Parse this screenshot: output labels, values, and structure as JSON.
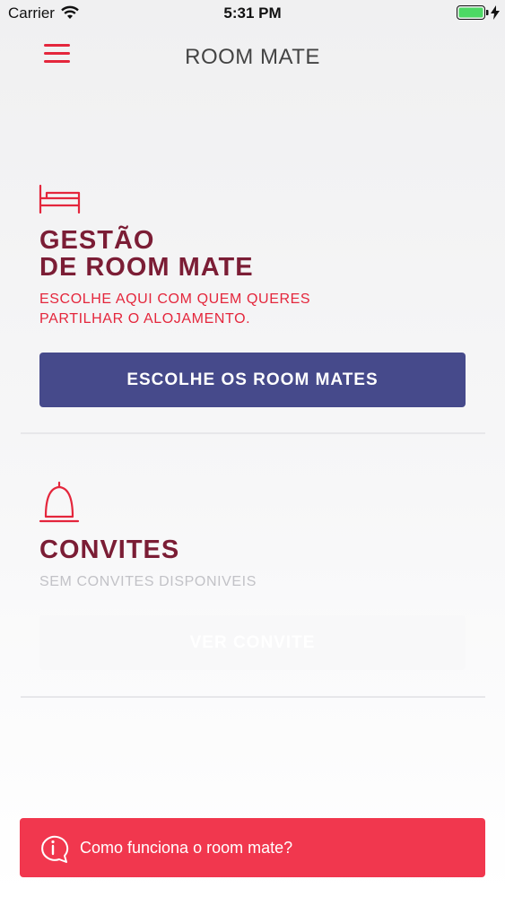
{
  "status_bar": {
    "carrier": "Carrier",
    "time": "5:31 PM",
    "icons": [
      "wifi-icon",
      "battery-icon",
      "charging-bolt-icon"
    ]
  },
  "header": {
    "title": "ROOM MATE",
    "menu_icon": "hamburger-menu-icon"
  },
  "management": {
    "icon": "bed-icon",
    "title_line1": "GESTÃO",
    "title_line2": "DE ROOM MATE",
    "subtitle_line1": "ESCOLHE AQUI COM QUEM QUERES",
    "subtitle_line2": "PARTILHAR O ALOJAMENTO.",
    "button_label": "ESCOLHE OS ROOM MATES"
  },
  "invites": {
    "icon": "bell-icon",
    "title": "CONVITES",
    "subtitle": "SEM CONVITES DISPONIVEIS",
    "button_label": "VER CONVITE"
  },
  "help": {
    "icon": "info-bubble-icon",
    "label": "Como funciona o room mate?"
  },
  "colors": {
    "accent_red": "#e4263c",
    "heading_maroon": "#7b1d35",
    "primary_button": "#464a8b",
    "help_banner": "#f1374e",
    "battery_green": "#4cd964"
  }
}
